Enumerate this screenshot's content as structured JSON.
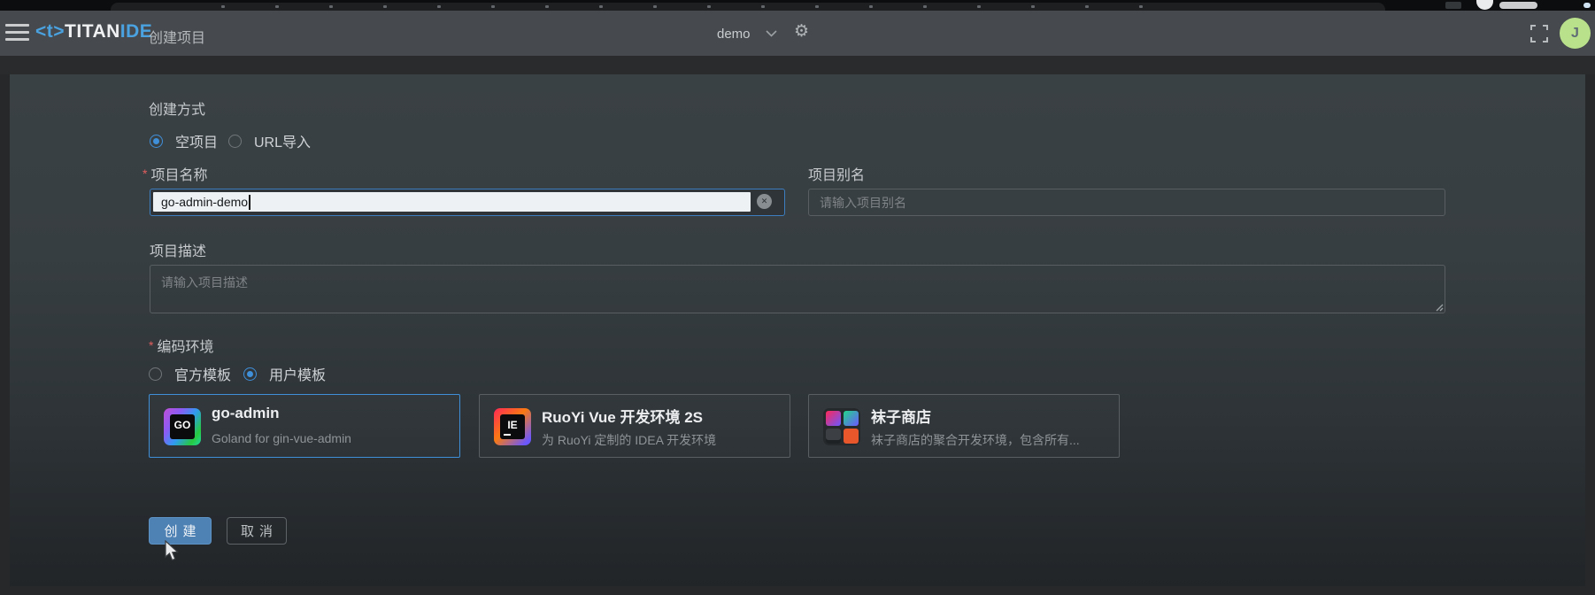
{
  "colors": {
    "accent_blue": "#3f8fd9",
    "button_blue": "#4e81b4",
    "avatar_green": "#b9e18c",
    "required_red": "#e25d5d",
    "header_bg": "#46494d",
    "panel_top": "#3a4145"
  },
  "top_strip": {
    "dot_count": 18
  },
  "header": {
    "logo_prefix": "<t>",
    "logo_main": "TITAN",
    "logo_suffix": "IDE",
    "page_title": "创建项目",
    "workspace": "demo",
    "avatar_initial": "J",
    "icons": [
      "menu-icon",
      "chevron-down-icon",
      "settings-gear-icon",
      "fullscreen-icon"
    ]
  },
  "form": {
    "creation_method": {
      "label": "创建方式",
      "options": [
        {
          "label": "空项目",
          "selected": true
        },
        {
          "label": "URL导入",
          "selected": false
        }
      ]
    },
    "project_name": {
      "label": "项目名称",
      "required": "*",
      "value": "go-admin-demo"
    },
    "project_alias": {
      "label": "项目别名",
      "placeholder": "请输入项目别名"
    },
    "project_description": {
      "label": "项目描述",
      "placeholder": "请输入项目描述"
    },
    "coding_env": {
      "label": "编码环境",
      "required": "*",
      "options": [
        {
          "label": "官方模板",
          "selected": false
        },
        {
          "label": "用户模板",
          "selected": true
        }
      ]
    },
    "templates": [
      {
        "title": "go-admin",
        "subtitle": "Goland for gin-vue-admin",
        "icon": "goland-icon",
        "icon_text": "GO",
        "selected": true
      },
      {
        "title": "RuoYi Vue 开发环境 2S",
        "subtitle": "为 RuoYi 定制的 IDEA 开发环境",
        "icon": "idea-icon",
        "icon_text": "IE",
        "selected": false
      },
      {
        "title": "袜子商店",
        "subtitle": "袜子商店的聚合开发环境，包含所有...",
        "icon": "multi-ide-icon",
        "icon_text": "",
        "selected": false
      }
    ],
    "actions": {
      "create": "创建",
      "cancel": "取消"
    }
  }
}
